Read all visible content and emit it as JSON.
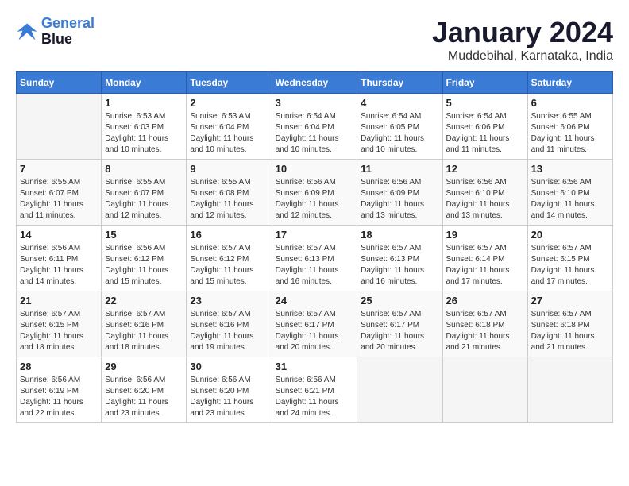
{
  "logo": {
    "line1": "General",
    "line2": "Blue"
  },
  "title": "January 2024",
  "location": "Muddebihal, Karnataka, India",
  "days_of_week": [
    "Sunday",
    "Monday",
    "Tuesday",
    "Wednesday",
    "Thursday",
    "Friday",
    "Saturday"
  ],
  "weeks": [
    [
      {
        "day": "",
        "info": ""
      },
      {
        "day": "1",
        "info": "Sunrise: 6:53 AM\nSunset: 6:03 PM\nDaylight: 11 hours and 10 minutes."
      },
      {
        "day": "2",
        "info": "Sunrise: 6:53 AM\nSunset: 6:04 PM\nDaylight: 11 hours and 10 minutes."
      },
      {
        "day": "3",
        "info": "Sunrise: 6:54 AM\nSunset: 6:04 PM\nDaylight: 11 hours and 10 minutes."
      },
      {
        "day": "4",
        "info": "Sunrise: 6:54 AM\nSunset: 6:05 PM\nDaylight: 11 hours and 10 minutes."
      },
      {
        "day": "5",
        "info": "Sunrise: 6:54 AM\nSunset: 6:06 PM\nDaylight: 11 hours and 11 minutes."
      },
      {
        "day": "6",
        "info": "Sunrise: 6:55 AM\nSunset: 6:06 PM\nDaylight: 11 hours and 11 minutes."
      }
    ],
    [
      {
        "day": "7",
        "info": "Sunrise: 6:55 AM\nSunset: 6:07 PM\nDaylight: 11 hours and 11 minutes."
      },
      {
        "day": "8",
        "info": "Sunrise: 6:55 AM\nSunset: 6:07 PM\nDaylight: 11 hours and 12 minutes."
      },
      {
        "day": "9",
        "info": "Sunrise: 6:55 AM\nSunset: 6:08 PM\nDaylight: 11 hours and 12 minutes."
      },
      {
        "day": "10",
        "info": "Sunrise: 6:56 AM\nSunset: 6:09 PM\nDaylight: 11 hours and 12 minutes."
      },
      {
        "day": "11",
        "info": "Sunrise: 6:56 AM\nSunset: 6:09 PM\nDaylight: 11 hours and 13 minutes."
      },
      {
        "day": "12",
        "info": "Sunrise: 6:56 AM\nSunset: 6:10 PM\nDaylight: 11 hours and 13 minutes."
      },
      {
        "day": "13",
        "info": "Sunrise: 6:56 AM\nSunset: 6:10 PM\nDaylight: 11 hours and 14 minutes."
      }
    ],
    [
      {
        "day": "14",
        "info": "Sunrise: 6:56 AM\nSunset: 6:11 PM\nDaylight: 11 hours and 14 minutes."
      },
      {
        "day": "15",
        "info": "Sunrise: 6:56 AM\nSunset: 6:12 PM\nDaylight: 11 hours and 15 minutes."
      },
      {
        "day": "16",
        "info": "Sunrise: 6:57 AM\nSunset: 6:12 PM\nDaylight: 11 hours and 15 minutes."
      },
      {
        "day": "17",
        "info": "Sunrise: 6:57 AM\nSunset: 6:13 PM\nDaylight: 11 hours and 16 minutes."
      },
      {
        "day": "18",
        "info": "Sunrise: 6:57 AM\nSunset: 6:13 PM\nDaylight: 11 hours and 16 minutes."
      },
      {
        "day": "19",
        "info": "Sunrise: 6:57 AM\nSunset: 6:14 PM\nDaylight: 11 hours and 17 minutes."
      },
      {
        "day": "20",
        "info": "Sunrise: 6:57 AM\nSunset: 6:15 PM\nDaylight: 11 hours and 17 minutes."
      }
    ],
    [
      {
        "day": "21",
        "info": "Sunrise: 6:57 AM\nSunset: 6:15 PM\nDaylight: 11 hours and 18 minutes."
      },
      {
        "day": "22",
        "info": "Sunrise: 6:57 AM\nSunset: 6:16 PM\nDaylight: 11 hours and 18 minutes."
      },
      {
        "day": "23",
        "info": "Sunrise: 6:57 AM\nSunset: 6:16 PM\nDaylight: 11 hours and 19 minutes."
      },
      {
        "day": "24",
        "info": "Sunrise: 6:57 AM\nSunset: 6:17 PM\nDaylight: 11 hours and 20 minutes."
      },
      {
        "day": "25",
        "info": "Sunrise: 6:57 AM\nSunset: 6:17 PM\nDaylight: 11 hours and 20 minutes."
      },
      {
        "day": "26",
        "info": "Sunrise: 6:57 AM\nSunset: 6:18 PM\nDaylight: 11 hours and 21 minutes."
      },
      {
        "day": "27",
        "info": "Sunrise: 6:57 AM\nSunset: 6:18 PM\nDaylight: 11 hours and 21 minutes."
      }
    ],
    [
      {
        "day": "28",
        "info": "Sunrise: 6:56 AM\nSunset: 6:19 PM\nDaylight: 11 hours and 22 minutes."
      },
      {
        "day": "29",
        "info": "Sunrise: 6:56 AM\nSunset: 6:20 PM\nDaylight: 11 hours and 23 minutes."
      },
      {
        "day": "30",
        "info": "Sunrise: 6:56 AM\nSunset: 6:20 PM\nDaylight: 11 hours and 23 minutes."
      },
      {
        "day": "31",
        "info": "Sunrise: 6:56 AM\nSunset: 6:21 PM\nDaylight: 11 hours and 24 minutes."
      },
      {
        "day": "",
        "info": ""
      },
      {
        "day": "",
        "info": ""
      },
      {
        "day": "",
        "info": ""
      }
    ]
  ]
}
